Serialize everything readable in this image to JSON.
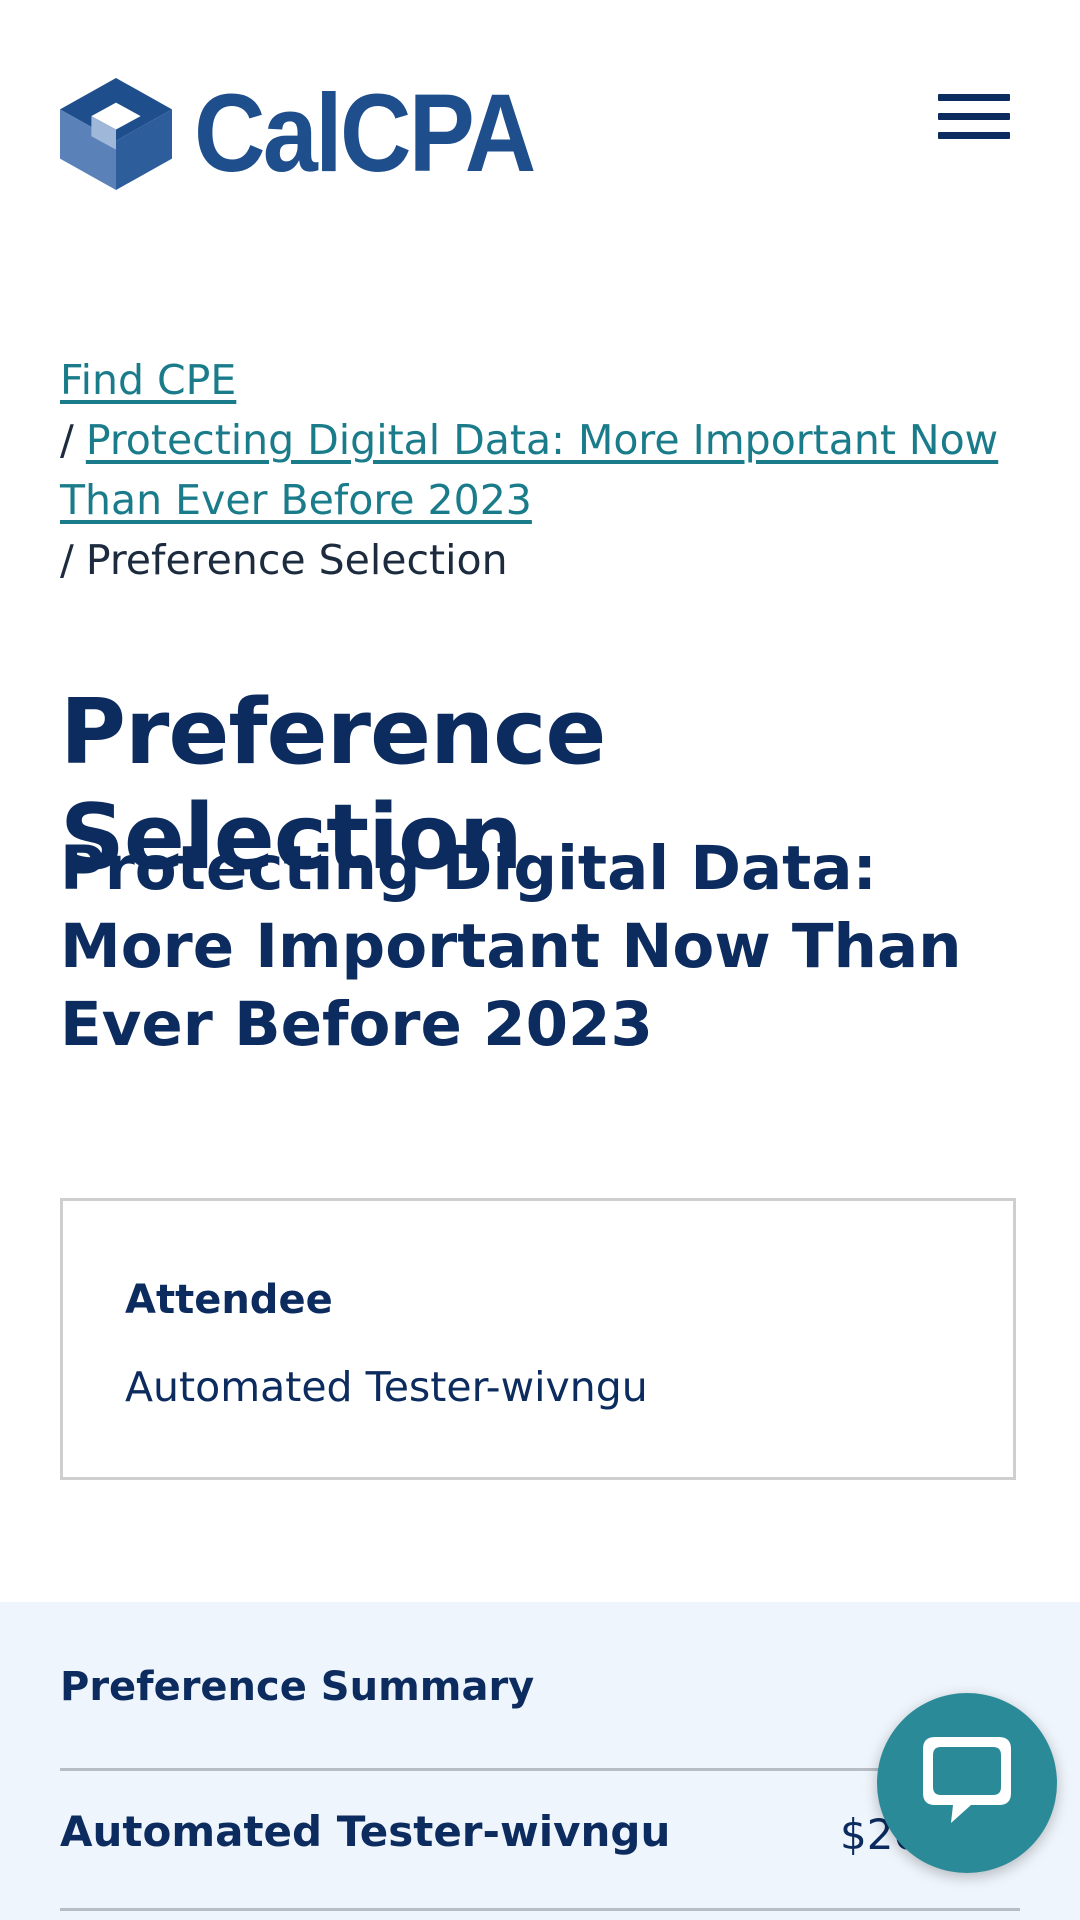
{
  "header": {
    "logo_text": "CalCPA",
    "logo_icon": "calcpa-cube-logo",
    "menu_icon": "hamburger-menu-icon"
  },
  "breadcrumb": {
    "items": [
      {
        "label": "Find CPE",
        "link": true
      },
      {
        "label": "Protecting Digital Data: More Important Now Than Ever Before 2023",
        "link": true
      },
      {
        "label": "Preference Selection",
        "link": false
      }
    ],
    "separator": "/"
  },
  "page": {
    "title": "Preference Selection",
    "subtitle": "Protecting Digital Data: More Important Now Than Ever Before 2023"
  },
  "attendee": {
    "label": "Attendee",
    "name": "Automated Tester-wivngu"
  },
  "summary": {
    "title": "Preference Summary",
    "rows": [
      {
        "name": "Automated Tester-wivngu",
        "price": "$20"
      }
    ]
  },
  "chat": {
    "icon": "chat-bubble-icon"
  },
  "colors": {
    "primary_navy": "#0c2b5e",
    "link_teal": "#1a7c8a",
    "logo_blue": "#1f4e8c",
    "summary_bg": "#eff5fc",
    "chat_teal": "#2b8a98"
  }
}
